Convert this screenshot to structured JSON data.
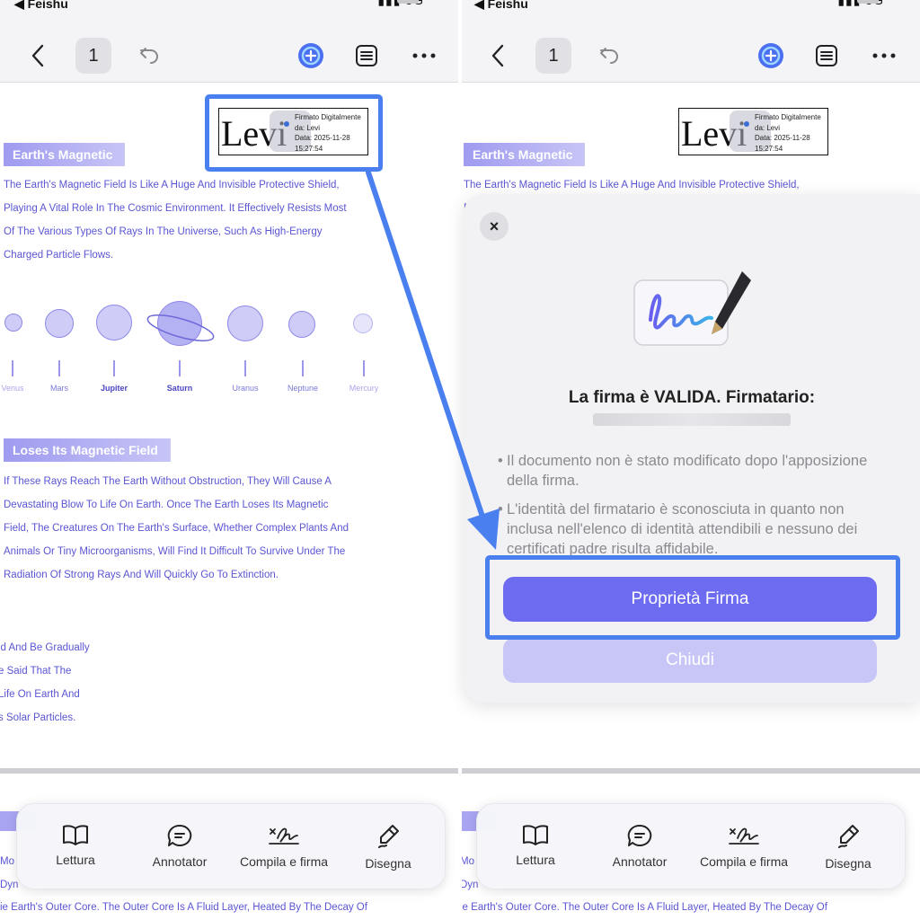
{
  "status_bar": {
    "back_app": "◀ Feishu",
    "signal": "▮▮▮ 5G"
  },
  "topbar": {
    "page_number": "1"
  },
  "document": {
    "signature": {
      "name": "Levi",
      "meta": [
        "Firmato Digitalmente",
        "da: Levi",
        "Data: 2025-11-28",
        "15:27:54"
      ]
    },
    "section1_title": "Earth's Magnetic",
    "section1_text": "The Earth's Magnetic Field Is Like A Huge And Invisible Protective Shield,\nPlaying A Vital Role In The Cosmic Environment. It Effectively Resists Most\nOf The Various Types Of Rays In The Universe, Such As High-Energy\nCharged Particle Flows.",
    "planets": [
      "Venus",
      "Mars",
      "Jupiter",
      "Saturn",
      "Uranus",
      "Neptune",
      "Mercury"
    ],
    "section2_title": "Loses Its Magnetic Field",
    "section2_text": "If These Rays Reach The Earth Without Obstruction, They Will Cause A\nDevastating Blow To Life On Earth. Once The Earth Loses Its Magnetic\nField, The Creatures On The Earth's Surface, Whether Complex Plants And\nAnimals Or Tiny Microorganisms, Will Find It Difficult To Survive Under The\nRadiation Of Strong Rays And Will Quickly Go To Extinction.",
    "section3_fragment": "ld And Be Gradually\ne Said That The\nLife On Earth And\ns Solar Particles.",
    "bottom_lines": [
      "Mo",
      "Dyn",
      "ie Earth's Outer Core. The Outer Core Is A Fluid Layer, Heated By The Decay Of"
    ]
  },
  "toolbar": {
    "items": [
      {
        "label": "Lettura",
        "icon": "book-icon"
      },
      {
        "label": "Annotator",
        "icon": "comment-icon"
      },
      {
        "label": "Compila e firma",
        "icon": "signature-icon"
      },
      {
        "label": "Disegna",
        "icon": "pen-icon"
      }
    ]
  },
  "dialog": {
    "close_label": "×",
    "title": "La firma è VALIDA. Firmatario:",
    "bullet1": "Il documento non è stato modificato dopo l'apposizione della firma.",
    "bullet2": "L'identità del firmatario è sconosciuta in quanto non inclusa nell'elenco di identità attendibili e nessuno dei certificati padre risulta affidabile.",
    "primary_button": "Proprietà Firma",
    "secondary_button": "Chiudi"
  },
  "colors": {
    "accent": "#6d6bf0",
    "annotation": "#4a7ff0",
    "doc_text": "#5a55d2",
    "heading_bg": "#9f9bf0"
  }
}
